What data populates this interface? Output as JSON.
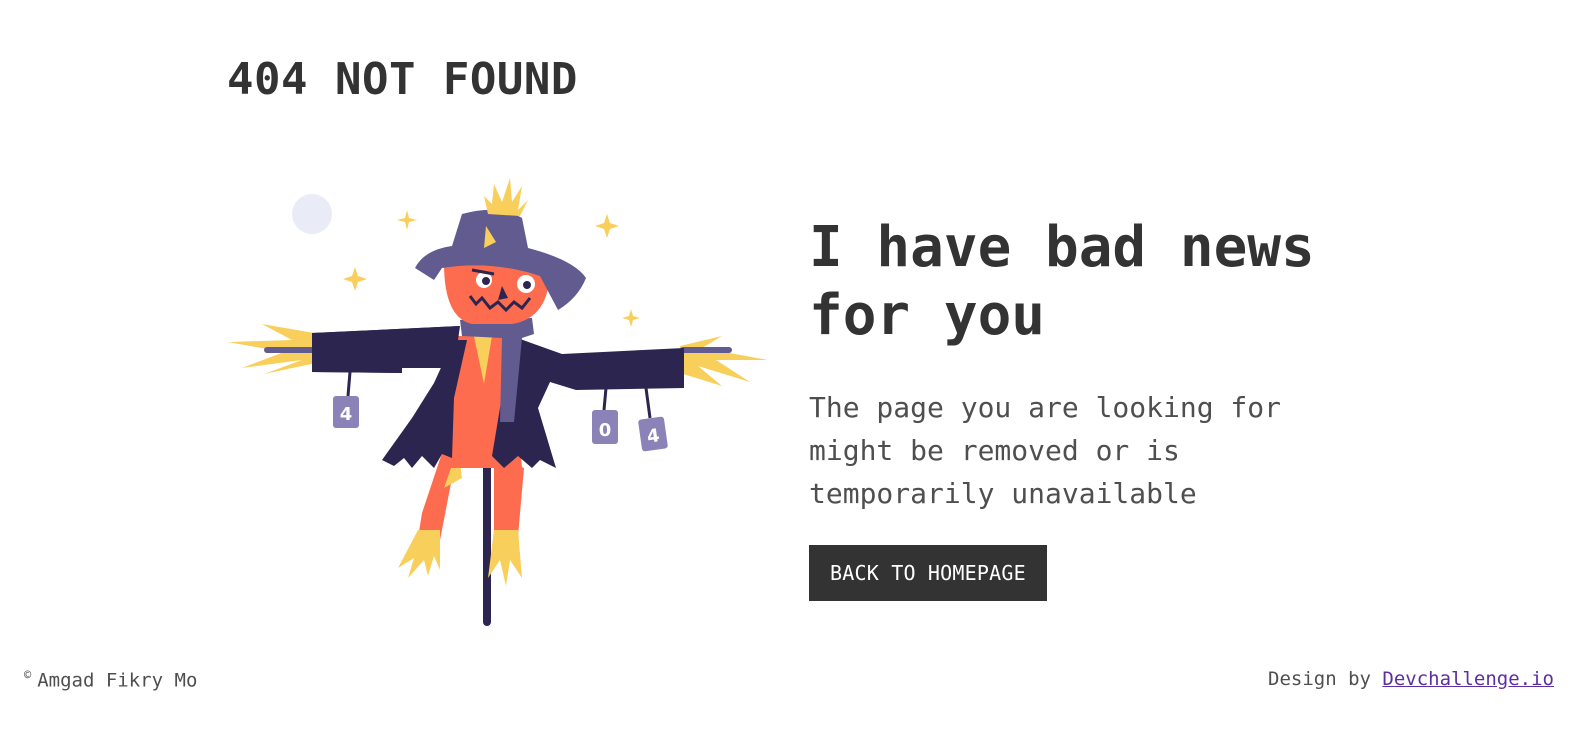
{
  "header": {
    "title": "404 NOT FOUND"
  },
  "main": {
    "headline": "I have bad news for you",
    "message": "The page you are looking for might be removed or is temporarily unavailable",
    "cta_label": "BACK TO HOMEPAGE"
  },
  "illustration": {
    "can_left": "4",
    "can_middle": "0",
    "can_right": "4"
  },
  "footer": {
    "copyright_symbol": "©",
    "author": "Amgad Fikry Mo",
    "design_prefix": "Design by ",
    "design_link": "Devchallenge.io"
  },
  "colors": {
    "text": "#333333",
    "button_bg": "#333333",
    "button_text": "#ffffff",
    "link": "#5c2fa0",
    "straw": "#f8cf5a",
    "pumpkin": "#fd6c4f",
    "coat": "#2c2550",
    "hat": "#625b90"
  }
}
